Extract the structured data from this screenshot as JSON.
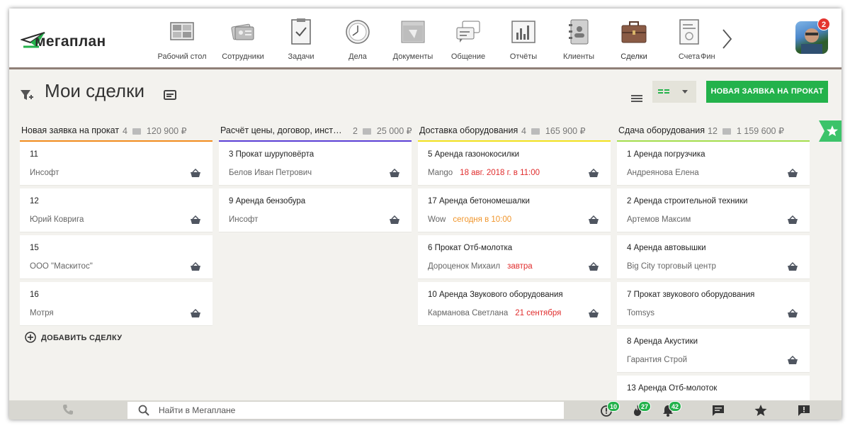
{
  "app": {
    "logo_text": "мегаплан"
  },
  "nav": {
    "items": [
      {
        "label": "Рабочий стол",
        "icon": "desktop-icon"
      },
      {
        "label": "Сотрудники",
        "icon": "employees-icon"
      },
      {
        "label": "Задачи",
        "icon": "tasks-icon"
      },
      {
        "label": "Дела",
        "icon": "clock-icon"
      },
      {
        "label": "Документы",
        "icon": "documents-icon"
      },
      {
        "label": "Общение",
        "icon": "chat-icon"
      },
      {
        "label": "Отчёты",
        "icon": "reports-icon"
      },
      {
        "label": "Клиенты",
        "icon": "clients-icon"
      },
      {
        "label": "Сделки",
        "icon": "briefcase-icon",
        "active": true
      },
      {
        "label": "Счета",
        "icon": "invoices-icon"
      },
      {
        "label": "Фин",
        "icon": "finance-icon"
      }
    ]
  },
  "user": {
    "notifications": "2"
  },
  "page": {
    "title": "Мои сделки",
    "new_button": "НОВАЯ ЗАЯВКА НА ПРОКАТ",
    "add_deal": "ДОБАВИТЬ СДЕЛКУ"
  },
  "colors": {
    "accent_green": "#23b24b",
    "col1": "#f28c1d",
    "col2": "#5b3fd6",
    "col3": "#f2e11d",
    "col4": "#a5de4d",
    "date_red": "#e02d2d",
    "date_orange": "#f0952b"
  },
  "columns": [
    {
      "name": "Новая заявка на прокат",
      "count": "4",
      "sum": "120 900 ₽",
      "cards": [
        {
          "title": "11",
          "client": "Инсофт"
        },
        {
          "title": "12",
          "client": "Юрий Коврига"
        },
        {
          "title": "15",
          "client": "ООО \"Маскитос\""
        },
        {
          "title": "16",
          "client": "Мотря"
        }
      ]
    },
    {
      "name": "Расчёт цены, договор, инстру...",
      "count": "2",
      "sum": "25 000 ₽",
      "cards": [
        {
          "title": "3 Прокат шуруповёрта",
          "client": "Белов Иван Петрович"
        },
        {
          "title": "9 Аренда бензобура",
          "client": "Инсофт"
        }
      ]
    },
    {
      "name": "Доставка оборудования",
      "count": "4",
      "sum": "165 900 ₽",
      "cards": [
        {
          "title": "5 Аренда газонокосилки",
          "client": "Mango",
          "date": "18 авг. 2018 г. в 11:00",
          "date_style": "red"
        },
        {
          "title": "17 Аренда бетономешалки",
          "client": "Wow",
          "date": "сегодня в 10:00",
          "date_style": "orange"
        },
        {
          "title": "6 Прокат Отб-молотка",
          "client": "Дороценок Михаил",
          "date": "завтра",
          "date_style": "red"
        },
        {
          "title": "10 Аренда Звукового оборудования",
          "client": "Карманова Светлана",
          "date": "21 сентября",
          "date_style": "red"
        }
      ]
    },
    {
      "name": "Сдача оборудования",
      "count": "12",
      "sum": "1 159 600 ₽",
      "cards": [
        {
          "title": "1 Аренда погрузчика",
          "client": "Андреянова Елена"
        },
        {
          "title": "2 Аренда строительной техники",
          "client": "Артемов Максим"
        },
        {
          "title": "4 Аренда автовышки",
          "client": "Big City торговый центр"
        },
        {
          "title": "7 Прокат звукового оборудования",
          "client": "Tomsys"
        },
        {
          "title": "8 Аренда Акустики",
          "client": "Гарантия Строй"
        },
        {
          "title": "13 Аренда Отб-молоток",
          "client": ""
        }
      ]
    }
  ],
  "search": {
    "placeholder": "Найти в Мегаплане"
  },
  "bottom_badges": {
    "alerts": "10",
    "hot": "27",
    "bell": "42"
  }
}
